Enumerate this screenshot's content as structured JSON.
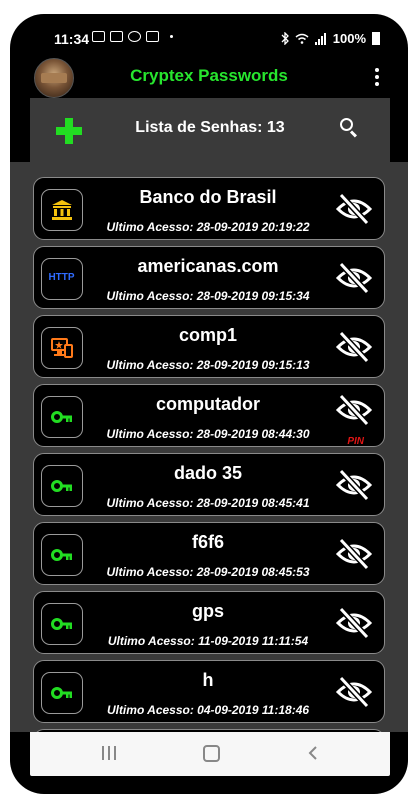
{
  "status_bar": {
    "time": "11:34",
    "battery": "100%"
  },
  "app": {
    "title": "Cryptex Passwords"
  },
  "toolbar": {
    "list_title": "Lista de Senhas: 13"
  },
  "entries": [
    {
      "name": "Banco do Brasil",
      "access": "Ultimo Acesso: 28-09-2019 20:19:22",
      "icon": "bank-icon",
      "icon_color": "#f4c20d"
    },
    {
      "name": "americanas.com",
      "access": "Ultimo Acesso: 28-09-2019 09:15:34",
      "icon": "http-icon",
      "icon_color": "#2f6bff",
      "icon_text": "HTTP"
    },
    {
      "name": "comp1",
      "access": "Ultimo Acesso: 28-09-2019 09:15:13",
      "icon": "devices-icon",
      "icon_color": "#ff7a1a"
    },
    {
      "name": "computador",
      "access": "Ultimo Acesso: 28-09-2019 08:44:30",
      "icon": "key-icon",
      "icon_color": "#22dd22",
      "badge": "PIN"
    },
    {
      "name": "dado 35",
      "access": "Ultimo Acesso: 28-09-2019 08:45:41",
      "icon": "key-icon",
      "icon_color": "#22dd22"
    },
    {
      "name": "f6f6",
      "access": "Ultimo Acesso: 28-09-2019 08:45:53",
      "icon": "key-icon",
      "icon_color": "#22dd22"
    },
    {
      "name": "gps",
      "access": "Ultimo Acesso: 11-09-2019 11:11:54",
      "icon": "key-icon",
      "icon_color": "#22dd22"
    },
    {
      "name": "h",
      "access": "Ultimo Acesso: 04-09-2019 11:18:46",
      "icon": "key-icon",
      "icon_color": "#22dd22"
    },
    {
      "name": "",
      "access": "",
      "icon": "key-icon",
      "icon_color": "#22dd22"
    }
  ],
  "colors": {
    "accent": "#27e52e",
    "pin": "#e01515",
    "background": "#000000",
    "toolbar": "#3a3a3a"
  }
}
